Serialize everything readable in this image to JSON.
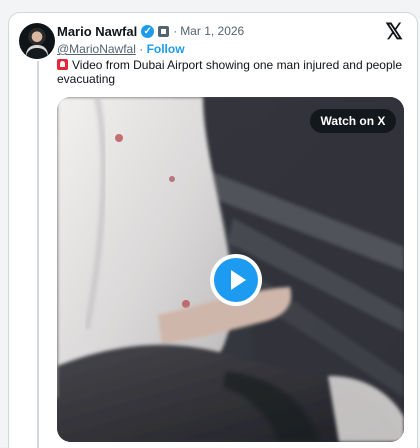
{
  "post": {
    "author_name": "Mario Nawfal",
    "verified_icon": "verified-badge-icon",
    "affiliation_icon": "affiliation-badge-icon",
    "separator": "·",
    "date": "Mar 1, 2026",
    "handle": "@MarioNawfal",
    "follow_label": "Follow",
    "text": "Video from Dubai Airport showing one man injured and people evacuating",
    "alert_icon": "siren-icon",
    "platform_icon": "x-logo-icon",
    "media": {
      "watch_label": "Watch on X",
      "play_icon": "play-icon"
    }
  },
  "colors": {
    "accent": "#1d9bf0",
    "text": "#0f1419",
    "muted": "#536471",
    "border": "#cfd9de",
    "alert": "#e5253a"
  }
}
